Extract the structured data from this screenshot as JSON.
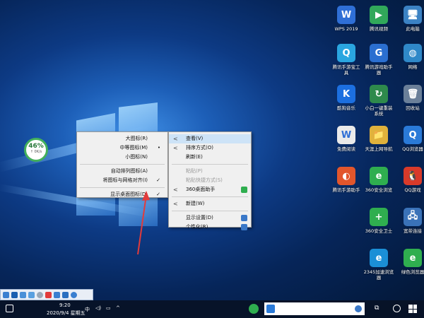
{
  "desktop_icons": [
    {
      "label": "WPS 2019",
      "glyph": "W",
      "color": "#2f6fd6",
      "type": "wps-icon"
    },
    {
      "label": "腾讯视频",
      "glyph": "▶",
      "color": "#31a85a",
      "type": "video-icon"
    },
    {
      "label": "此电脑",
      "glyph": "🖥",
      "color": "#3b82c4",
      "type": "computer-icon"
    },
    {
      "label": "腾讯手游宝工具",
      "glyph": "Q",
      "color": "#2aa6e0",
      "type": "game-tool-icon"
    },
    {
      "label": "腾讯游戏助手器",
      "glyph": "G",
      "color": "#2b6fd0",
      "type": "game-helper-icon"
    },
    {
      "label": "网络",
      "glyph": "◍",
      "color": "#2f88c8",
      "type": "network-icon"
    },
    {
      "label": "酷狗音乐",
      "glyph": "K",
      "color": "#1c6fe0",
      "type": "music-icon"
    },
    {
      "label": "小白一键重装系统",
      "glyph": "↻",
      "color": "#2e8a4c",
      "type": "reinstall-icon"
    },
    {
      "label": "回收站",
      "glyph": "🗑",
      "color": "#6a7f99",
      "type": "recycle-bin-icon"
    },
    {
      "label": "免费阅读",
      "glyph": "W",
      "color": "#eaeaea",
      "type": "reader-icon"
    },
    {
      "label": "天涯上网导航",
      "glyph": "📁",
      "color": "#e0b23c",
      "type": "folder-icon"
    },
    {
      "label": "QQ浏览器",
      "glyph": "Q",
      "color": "#2a7ad8",
      "type": "qq-browser-icon"
    },
    {
      "label": "腾讯手游助手",
      "glyph": "◐",
      "color": "#e2562c",
      "type": "mobile-game-icon"
    },
    {
      "label": "360安全浏览",
      "glyph": "e",
      "color": "#2fae4f",
      "type": "browser-360-icon"
    },
    {
      "label": "QQ游戏",
      "glyph": "🐧",
      "color": "#d83a2a",
      "type": "qq-game-icon"
    },
    {
      "label": "360安全卫士",
      "glyph": "+",
      "color": "#2fae4f",
      "type": "security-360-icon"
    },
    {
      "label": "宽带连接",
      "glyph": "🖧",
      "color": "#3a72b8",
      "type": "broadband-icon"
    },
    {
      "label": "2345加速浏览器",
      "glyph": "e",
      "color": "#1b8fd6",
      "type": "browser-2345-icon"
    },
    {
      "label": "绿色浏览器",
      "glyph": "e",
      "color": "#2fae4f",
      "type": "green-browser-icon"
    }
  ],
  "widget": {
    "percent": "46%",
    "sub": "↑ 0K/s"
  },
  "main_menu": [
    {
      "label": "查看(V)",
      "arrow": "<",
      "highlight": true
    },
    {
      "label": "排序方式(O)",
      "arrow": "<"
    },
    {
      "label": "刷新(E)"
    },
    {
      "sep": true
    },
    {
      "label": "粘贴(P)",
      "disabled": true
    },
    {
      "label": "粘贴快捷方式(S)",
      "disabled": true
    },
    {
      "label": "360桌面助手",
      "arrow": "<",
      "icon": "#2fae4f"
    },
    {
      "sep": true
    },
    {
      "label": "新建(W)",
      "arrow": "<"
    },
    {
      "sep": true
    },
    {
      "label": "显示设置(D)",
      "icon": "#3a78c8"
    },
    {
      "label": "个性化(R)",
      "icon": "#3a78c8"
    }
  ],
  "view_menu": [
    {
      "label": "大图标(R)"
    },
    {
      "label": "中等图标(M)",
      "mark": "•"
    },
    {
      "label": "小图标(N)"
    },
    {
      "sep": true
    },
    {
      "label": "自动排列图标(A)"
    },
    {
      "label": "将图标与网格对齐(I)",
      "mark": "✓"
    },
    {
      "sep": true
    },
    {
      "label": "显示桌面图标(D)",
      "mark": "✓"
    }
  ],
  "taskbar": {
    "time": "9:20",
    "date": "2020/9/4 星期五",
    "lang": "中",
    "search_placeholder": ""
  }
}
